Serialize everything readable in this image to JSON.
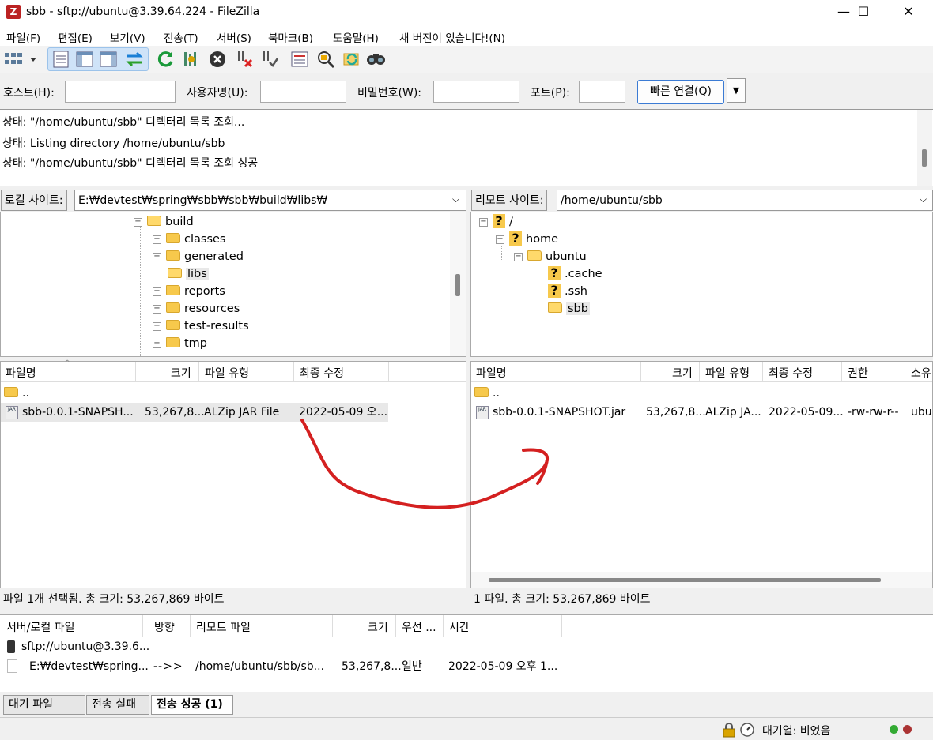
{
  "window": {
    "title": "sbb - sftp://ubuntu@3.39.64.224 - FileZilla",
    "app_icon": "Z",
    "minimize": "—",
    "maximize": "☐",
    "close": "✕"
  },
  "menu": [
    "파일(F)",
    "편집(E)",
    "보기(V)",
    "전송(T)",
    "서버(S)",
    "북마크(B)",
    "도움말(H)",
    "새 버전이 있습니다!(N)"
  ],
  "quickconnect": {
    "host_label": "호스트(H):",
    "user_label": "사용자명(U):",
    "pass_label": "비밀번호(W):",
    "port_label": "포트(P):",
    "connect_button": "빠른 연결(Q)",
    "host_value": "",
    "user_value": "",
    "pass_value": "",
    "port_value": ""
  },
  "log": [
    "상태:  \"/home/ubuntu/sbb\" 디렉터리 목록 조회...",
    "상태:  Listing directory /home/ubuntu/sbb",
    "상태:  \"/home/ubuntu/sbb\" 디렉터리 목록 조회 성공"
  ],
  "local": {
    "site_label": "로컬 사이트:",
    "path": "E:₩devtest₩spring₩sbb₩sbb₩build₩libs₩",
    "tree": [
      {
        "label": "build",
        "expander": "⊟"
      },
      {
        "label": "classes",
        "expander": "⊞"
      },
      {
        "label": "generated",
        "expander": "⊞"
      },
      {
        "label": "libs",
        "expander": ""
      },
      {
        "label": "reports",
        "expander": "⊞"
      },
      {
        "label": "resources",
        "expander": "⊞"
      },
      {
        "label": "test-results",
        "expander": "⊞"
      },
      {
        "label": "tmp",
        "expander": "⊞"
      }
    ],
    "columns": [
      "파일명",
      "크기",
      "파일 유형",
      "최종 수정"
    ],
    "parent": "..",
    "files": [
      {
        "name": "sbb-0.0.1-SNAPSH...",
        "size": "53,267,8...",
        "type": "ALZip JAR File",
        "modified": "2022-05-09 오..."
      }
    ],
    "status": "파일 1개 선택됨. 총 크기: 53,267,869 바이트"
  },
  "remote": {
    "site_label": "리모트 사이트:",
    "path": "/home/ubuntu/sbb",
    "tree": [
      {
        "label": "/"
      },
      {
        "label": "home"
      },
      {
        "label": "ubuntu"
      },
      {
        "label": ".cache"
      },
      {
        "label": ".ssh"
      },
      {
        "label": "sbb"
      }
    ],
    "columns": [
      "파일명",
      "크기",
      "파일 유형",
      "최종 수정",
      "권한",
      "소유"
    ],
    "parent": "..",
    "files": [
      {
        "name": "sbb-0.0.1-SNAPSHOT.jar",
        "size": "53,267,8...",
        "type": "ALZip JA...",
        "modified": "2022-05-09...",
        "perm": "-rw-rw-r--",
        "owner": "ubu"
      }
    ],
    "status": "1 파일. 총 크기: 53,267,869 바이트"
  },
  "queue": {
    "columns": [
      "서버/로컬 파일",
      "방향",
      "리모트 파일",
      "크기",
      "우선 ...",
      "시간"
    ],
    "server": "sftp://ubuntu@3.39.6...",
    "row": {
      "local": "E:₩devtest₩spring...",
      "direction": "-->>",
      "remote": "/home/ubuntu/sbb/sb...",
      "size": "53,267,8...",
      "priority": "일반",
      "time": "2022-05-09 오후 1..."
    }
  },
  "tabs": [
    "대기 파일",
    "전송 실패",
    "전송 성공 (1)"
  ],
  "statusbar": {
    "queue": "대기열: 비었음"
  },
  "colors": {
    "accent": "#3b7bd4",
    "annotation_arrow": "#d42020",
    "folder": "#f7c94c"
  }
}
